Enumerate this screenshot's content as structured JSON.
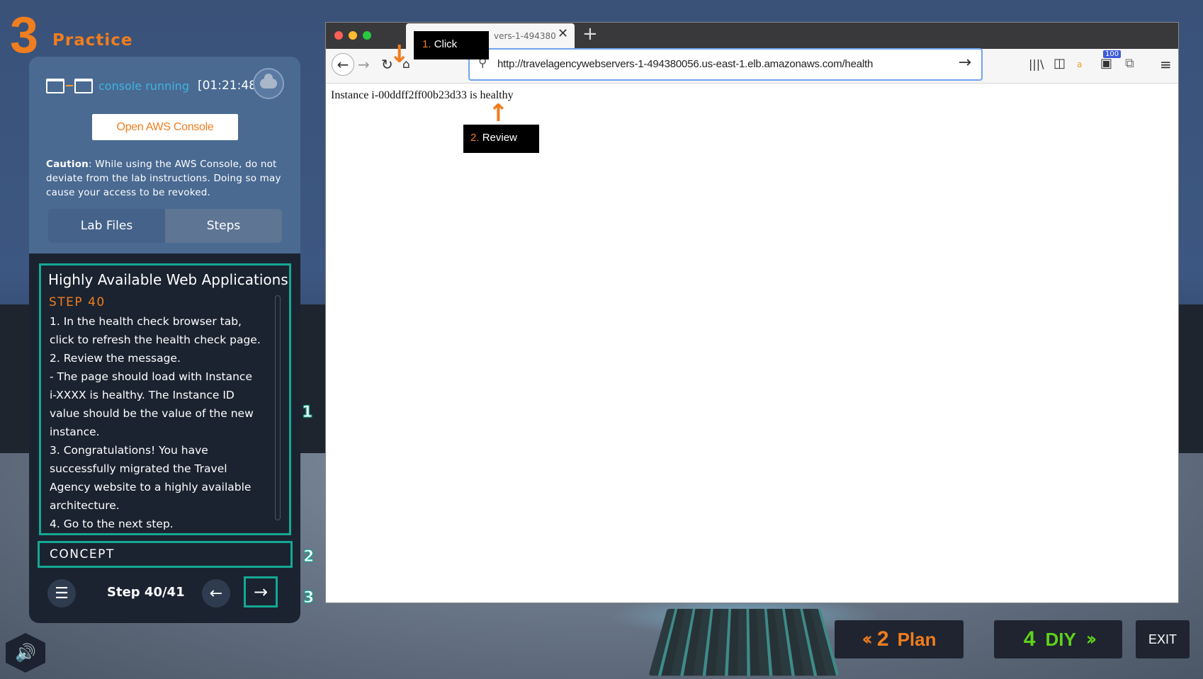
{
  "header": {
    "number": "3",
    "label": "Practice"
  },
  "console": {
    "status": "console running",
    "timer": "[01:21:48]",
    "open_button": "Open AWS Console"
  },
  "caution": {
    "label": "Caution",
    "text": ": While using the AWS Console, do not deviate from the lab instructions. Doing so may cause your access to be revoked."
  },
  "tabs": {
    "lab_files": "Lab Files",
    "steps": "Steps"
  },
  "steps": {
    "title": "Highly Available Web Applications",
    "step_label": "STEP 40",
    "lines": [
      "1. In the health check browser tab, click to refresh the health check page.",
      "2. Review the message.",
      "- The page should load with Instance i-XXXX is healthy. The Instance ID value should be the value of the new instance.",
      "3. Congratulations! You have successfully migrated the Travel Agency website to a highly available architecture.",
      "4. Go to the next step."
    ],
    "concept": "CONCEPT",
    "step_count": "Step 40/41"
  },
  "markers": [
    "1",
    "2",
    "3"
  ],
  "browser": {
    "tab_title": "vers-1-494380",
    "url": "http://travelagencywebservers-1-494380056.us-east-1.elb.amazonaws.com/health",
    "page_text": "Instance i-00ddff2ff00b23d33 is healthy",
    "badge": "100",
    "callout_click_num": "1.",
    "callout_click": "Click",
    "callout_review_num": "2.",
    "callout_review": "Review"
  },
  "bottom": {
    "plan_num": "2",
    "plan_label": "Plan",
    "diy_num": "4",
    "diy_label": "DIY",
    "exit": "EXIT"
  },
  "colors": {
    "accent_orange": "#f07d1e",
    "teal": "#14a895",
    "green": "#5fd11a",
    "link_blue": "#3fb3e0"
  },
  "icons": [
    "console-window-icon",
    "cloud-icon",
    "list-icon",
    "arrow-left-icon",
    "arrow-right-icon",
    "speaker-icon",
    "back-icon",
    "forward-icon",
    "reload-icon",
    "home-icon",
    "search-icon",
    "library-icon",
    "sidebar-icon",
    "amazon-icon",
    "screenshot-icon",
    "crop-icon",
    "menu-icon"
  ]
}
